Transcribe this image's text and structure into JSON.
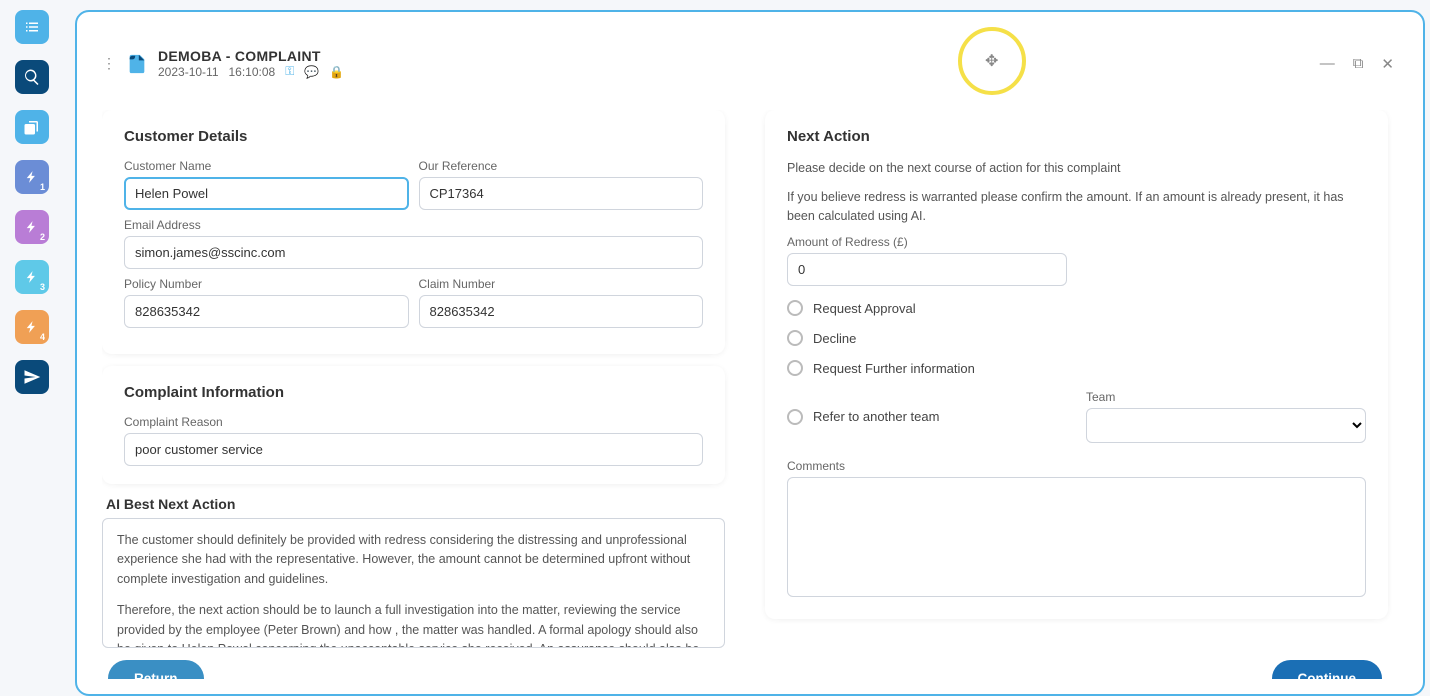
{
  "header": {
    "title": "DEMOBA - COMPLAINT",
    "date": "2023-10-11",
    "time": "16:10:08"
  },
  "customer": {
    "section_title": "Customer Details",
    "name_label": "Customer Name",
    "name_value": "Helen Powel",
    "ref_label": "Our Reference",
    "ref_value": "CP17364",
    "email_label": "Email Address",
    "email_value": "simon.james@sscinc.com",
    "policy_label": "Policy Number",
    "policy_value": "828635342",
    "claim_label": "Claim Number",
    "claim_value": "828635342"
  },
  "complaint": {
    "section_title": "Complaint Information",
    "reason_label": "Complaint Reason",
    "reason_value": "poor customer service"
  },
  "ai": {
    "title": "AI Best Next Action",
    "p1": "The customer should definitely be provided with redress considering the distressing and unprofessional experience she had with the representative. However, the amount cannot be determined upfront without complete investigation and guidelines.",
    "p2": "Therefore, the next action should be to launch a full investigation into the matter, reviewing the service provided by the employee (Peter Brown) and how , the matter was handled. A formal apology should also be given to Helen Powel concerning the unacceptable service she received. An assurance should also be communicated that her experience is not representative of the company's standard of service."
  },
  "next": {
    "section_title": "Next Action",
    "help1": "Please decide on the next course of action for this complaint",
    "help2": "If you believe redress is warranted please confirm the amount. If an amount is already present, it has been calculated using AI.",
    "amount_label": "Amount of Redress (£)",
    "amount_value": "0",
    "opt_approval": "Request Approval",
    "opt_decline": "Decline",
    "opt_further": "Request Further information",
    "opt_refer": "Refer to another team",
    "team_label": "Team",
    "comments_label": "Comments"
  },
  "footer": {
    "return": "Return",
    "continue": "Continue"
  }
}
